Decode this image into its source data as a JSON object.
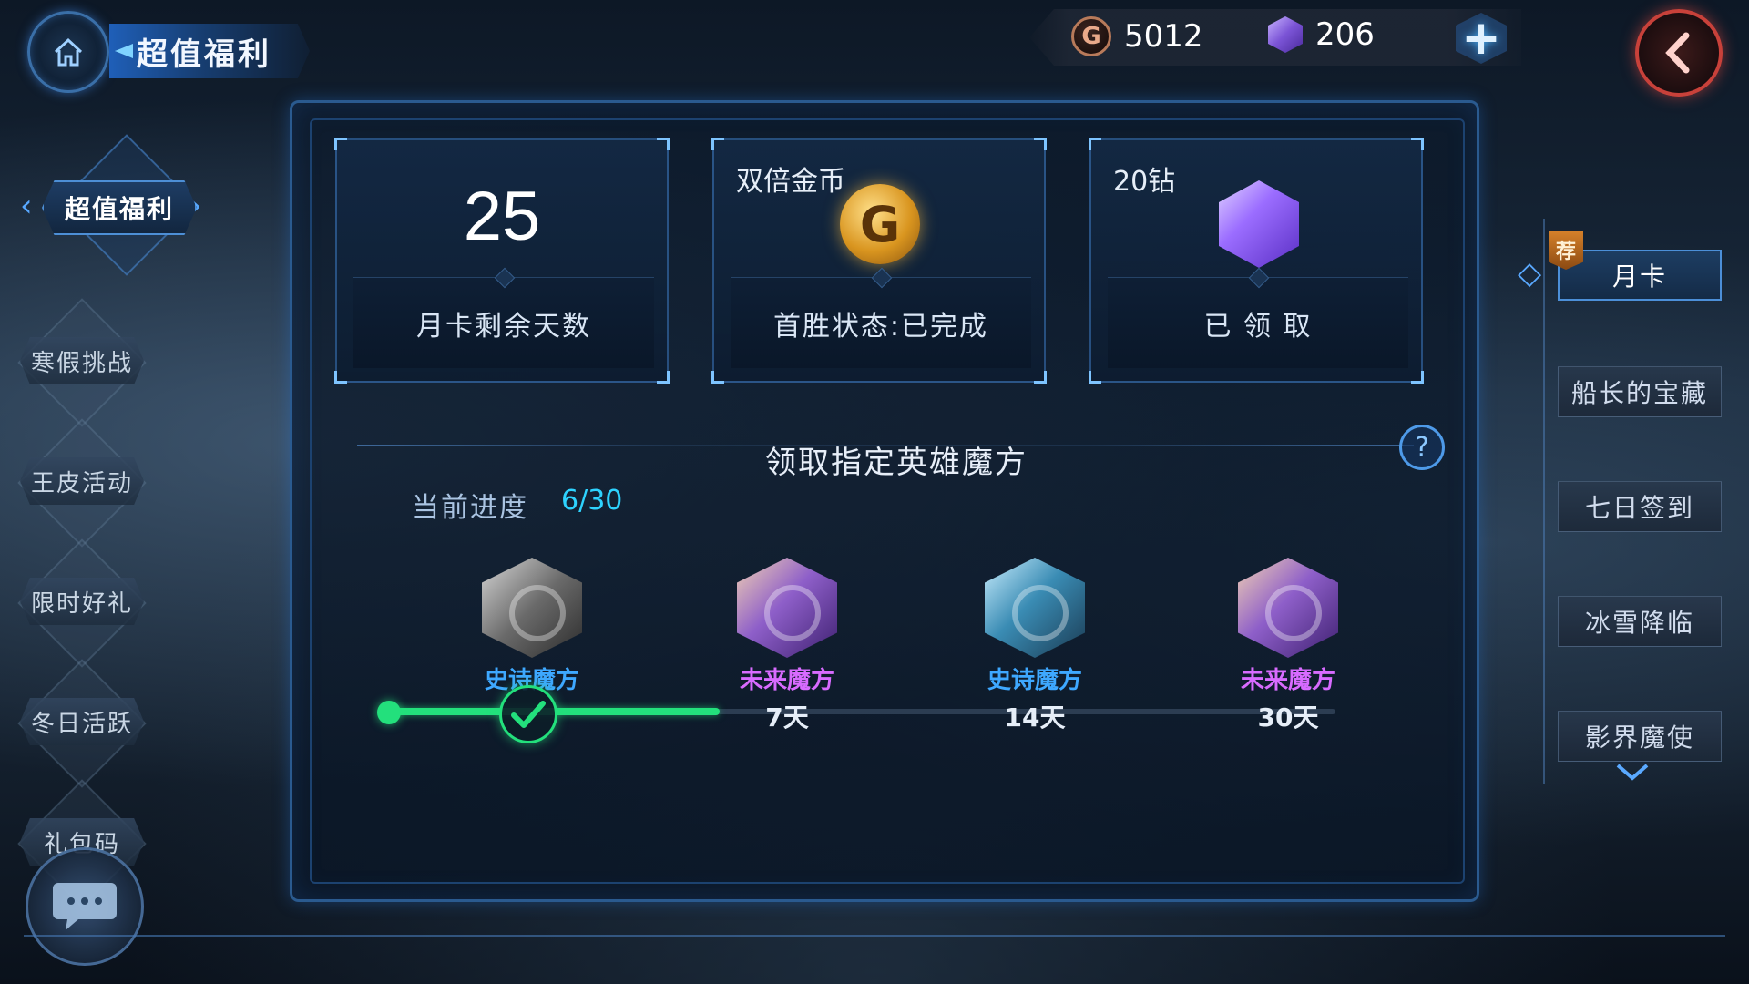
{
  "header": {
    "title": "超值福利",
    "gold": "5012",
    "gems": "206",
    "gold_symbol": "G"
  },
  "left_nav": {
    "active": "超值福利",
    "items": [
      "寒假挑战",
      "王皮活动",
      "限时好礼",
      "冬日活跃",
      "礼包码"
    ]
  },
  "cards": [
    {
      "value": "25",
      "label": "月卡剩余天数"
    },
    {
      "title": "双倍金币",
      "label": "首胜状态:已完成",
      "icon": "gold-coin-icon",
      "symbol": "G"
    },
    {
      "title": "20钻",
      "label": "已 领 取",
      "icon": "purple-gem-icon"
    }
  ],
  "section": {
    "title": "领取指定英雄魔方",
    "progress_label": "当前进度",
    "progress_value": "6/30",
    "progress": {
      "current": 6,
      "total": 30
    }
  },
  "rewards": [
    {
      "name": "史诗魔方",
      "days": "",
      "cube_color": "gray",
      "claimed": true
    },
    {
      "name": "未来魔方",
      "days": "7天",
      "cube_color": "purple",
      "claimed": false
    },
    {
      "name": "史诗魔方",
      "days": "14天",
      "cube_color": "teal",
      "claimed": false
    },
    {
      "name": "未来魔方",
      "days": "30天",
      "cube_color": "purple",
      "claimed": false
    }
  ],
  "right_tabs": {
    "badge": "荐",
    "items": [
      "月卡",
      "船长的宝藏",
      "七日签到",
      "冰雪降临",
      "影界魔使"
    ],
    "active_index": 0
  },
  "colors": {
    "accent_blue": "#4c8fd8",
    "progress_green": "#23e07c",
    "progress_text": "#2ed3ff",
    "epic_blue": "#3ea8ff",
    "future_purple": "#d86bff"
  }
}
